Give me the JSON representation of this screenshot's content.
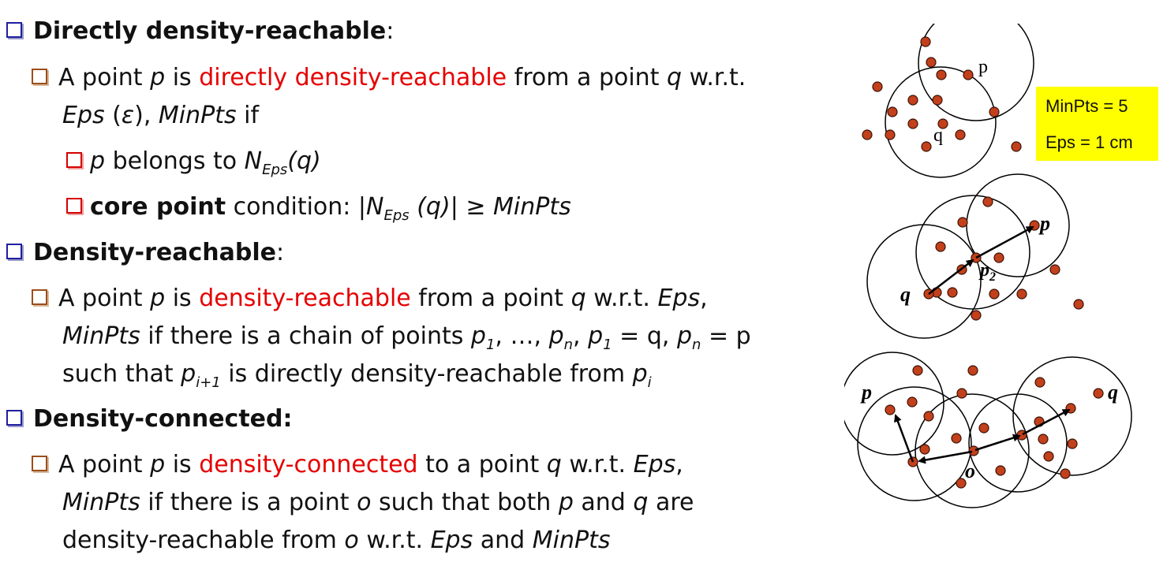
{
  "sections": [
    {
      "heading": "Directly density-reachable",
      "heading_suffix": ":",
      "line1": [
        "A point ",
        "p",
        " is ",
        "directly density-reachable",
        " from a point ",
        "q",
        " w.r.t."
      ],
      "line2": [
        "Eps",
        " (",
        "ε",
        "), ",
        "MinPts",
        " if"
      ],
      "cond1": [
        "p",
        " belongs to ",
        "N",
        "Eps",
        "(q)"
      ],
      "cond2": [
        "core point",
        " condition: |",
        "N",
        "Eps",
        " (q)",
        "| ≥ ",
        "MinPts"
      ]
    },
    {
      "heading": "Density-reachable",
      "heading_suffix": ":",
      "line1": [
        "A point ",
        "p",
        " is ",
        "density-reachable",
        " from a point ",
        "q",
        " w.r.t. ",
        "Eps",
        ","
      ],
      "line2": [
        "MinPts",
        " if there is a chain of points ",
        "p",
        "1",
        ", …, ",
        "p",
        "n",
        ", ",
        "p",
        "1",
        " = q, ",
        "p",
        "n",
        " = p"
      ],
      "line3": [
        "such that ",
        "p",
        "i+1",
        " is directly density-reachable from ",
        "p",
        "i"
      ]
    },
    {
      "heading": "Density-connected:",
      "line1": [
        "A point ",
        "p",
        " is ",
        "density-connected",
        " to a point ",
        "q",
        " w.r.t. ",
        "Eps",
        ","
      ],
      "line2": [
        "MinPts",
        " if there is a point ",
        "o",
        " such that both ",
        "p",
        " and ",
        "q",
        " are"
      ],
      "line3": [
        "density-reachable from ",
        "o",
        " w.r.t. ",
        "Eps",
        " and ",
        "MinPts"
      ]
    }
  ],
  "params_box": {
    "minpts": "MinPts = 5",
    "eps": "Eps = 1 cm"
  },
  "diagram_labels": {
    "d1_p": "p",
    "d1_q": "q",
    "d2_p": "p",
    "d2_q": "q",
    "d2_p2_base": "p",
    "d2_p2_sub": "2",
    "d3_p": "p",
    "d3_q": "q",
    "d3_o": "o"
  },
  "colors": {
    "point_fill": "#c2401c",
    "highlight": "#e60000",
    "box": "#ffff00"
  }
}
